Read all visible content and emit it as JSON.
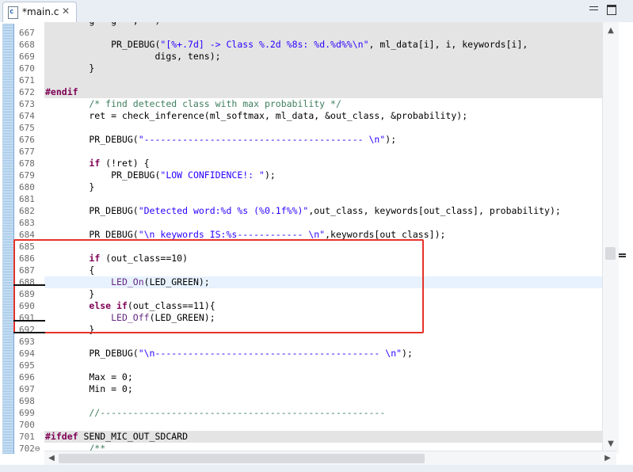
{
  "tab": {
    "icon": "c-file-icon",
    "icon_glyph": "c",
    "label": "*main.c",
    "close": "✕"
  },
  "window_controls": {
    "minimize": "minimize-icon",
    "maximize": "maximize-icon"
  },
  "scroll": {
    "up": "▲",
    "down": "▼",
    "left": "◀",
    "right": "▶"
  },
  "lines": [
    {
      "n": "",
      "c": "        g   g   ,   )"
    },
    {
      "n": "667",
      "c": ""
    },
    {
      "n": "668",
      "c": "            PR_DEBUG(\"[%+.7d] -> Class %.2d %8s: %d.%d%%\\n\", ml_data[i], i, keywords[i],"
    },
    {
      "n": "669",
      "c": "                    digs, tens);"
    },
    {
      "n": "670",
      "c": "        }"
    },
    {
      "n": "671",
      "c": ""
    },
    {
      "n": "672",
      "c": "#endif"
    },
    {
      "n": "673",
      "c": "        /* find detected class with max probability */"
    },
    {
      "n": "674",
      "c": "        ret = check_inference(ml_softmax, ml_data, &out_class, &probability);"
    },
    {
      "n": "675",
      "c": ""
    },
    {
      "n": "676",
      "c": "        PR_DEBUG(\"---------------------------------------- \\n\");"
    },
    {
      "n": "677",
      "c": ""
    },
    {
      "n": "678",
      "c": "        if (!ret) {"
    },
    {
      "n": "679",
      "c": "            PR_DEBUG(\"LOW CONFIDENCE!: \");"
    },
    {
      "n": "680",
      "c": "        }"
    },
    {
      "n": "681",
      "c": ""
    },
    {
      "n": "682",
      "c": "        PR_DEBUG(\"Detected word:%d %s (%0.1f%%)\",out_class, keywords[out_class], probability);"
    },
    {
      "n": "683",
      "c": ""
    },
    {
      "n": "684",
      "c": "        PR_DEBUG(\"\\n keywords IS:%s------------ \\n\",keywords[out_class]);"
    },
    {
      "n": "685",
      "c": ""
    },
    {
      "n": "686",
      "c": "        if (out_class==10)"
    },
    {
      "n": "687",
      "c": "        {"
    },
    {
      "n": "688",
      "c": "            LED_On(LED_GREEN);"
    },
    {
      "n": "689",
      "c": "        }"
    },
    {
      "n": "690",
      "c": "        else if(out_class==11){"
    },
    {
      "n": "691",
      "c": "            LED_Off(LED_GREEN);"
    },
    {
      "n": "692",
      "c": "        }"
    },
    {
      "n": "693",
      "c": ""
    },
    {
      "n": "694",
      "c": "        PR_DEBUG(\"\\n----------------------------------------- \\n\");"
    },
    {
      "n": "695",
      "c": ""
    },
    {
      "n": "696",
      "c": "        Max = 0;"
    },
    {
      "n": "697",
      "c": "        Min = 0;"
    },
    {
      "n": "698",
      "c": ""
    },
    {
      "n": "699",
      "c": "        //----------------------------------------------------"
    },
    {
      "n": "700",
      "c": ""
    },
    {
      "n": "701",
      "c": "#ifdef SEND_MIC_OUT_SDCARD"
    },
    {
      "n": "702⊖",
      "c": "        /**"
    }
  ]
}
